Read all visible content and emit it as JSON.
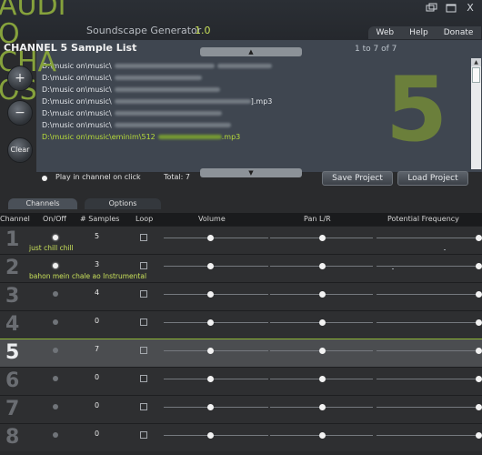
{
  "header": {
    "logo_lines": [
      "AUDI",
      "O",
      "CHA",
      "OS"
    ],
    "app_title": "Soundscape Generator",
    "version": "1.0",
    "window_icons": [
      "restore-icon",
      "maximize-icon",
      "close-icon"
    ],
    "close_glyph": "X",
    "menu": [
      "Web",
      "Help",
      "Donate"
    ]
  },
  "sample_panel": {
    "title": "CHANNEL 5 Sample List",
    "count": "1 to 7 of 7",
    "big_number": "5",
    "items": [
      {
        "prefix": "D:\\music on\\music\\",
        "suffix": ""
      },
      {
        "prefix": "D:\\music on\\music\\",
        "suffix": ""
      },
      {
        "prefix": "D:\\music on\\music\\",
        "suffix": ""
      },
      {
        "prefix": "D:\\music on\\music\\",
        "suffix": "].mp3"
      },
      {
        "prefix": "D:\\music on\\music\\",
        "suffix": ""
      },
      {
        "prefix": "D:\\music on\\music\\",
        "suffix": ""
      },
      {
        "prefix": "D:\\music on\\music\\eminim\\512",
        "suffix": ".mp3"
      }
    ],
    "play_in_channel_label": "Play in channel on click",
    "total_label": "Total: 7",
    "save_button": "Save Project",
    "load_button": "Load Project"
  },
  "side_buttons": {
    "add": "+",
    "remove": "−",
    "clear": "Clear"
  },
  "tabs": [
    "Channels",
    "Options"
  ],
  "columns": [
    "Channel",
    "On/Off",
    "# Samples",
    "Loop",
    "Volume",
    "Pan L/R",
    "Potential Frequency"
  ],
  "channels": [
    {
      "num": "1",
      "name": "just chill chill",
      "on": true,
      "samples": "5",
      "volume": 0.44,
      "pan": 0.5,
      "freq": 0.98
    },
    {
      "num": "2",
      "name": "bahon mein chale ao Instrumental",
      "on": true,
      "samples": "3",
      "volume": 0.44,
      "pan": 0.5,
      "freq": 0.98
    },
    {
      "num": "3",
      "name": "",
      "on": false,
      "samples": "4",
      "volume": 0.44,
      "pan": 0.5,
      "freq": 0.98
    },
    {
      "num": "4",
      "name": "",
      "on": false,
      "samples": "0",
      "volume": 0.44,
      "pan": 0.5,
      "freq": 0.98
    },
    {
      "num": "5",
      "name": "",
      "on": false,
      "samples": "7",
      "volume": 0.44,
      "pan": 0.5,
      "freq": 0.98,
      "selected": true
    },
    {
      "num": "6",
      "name": "",
      "on": false,
      "samples": "0",
      "volume": 0.44,
      "pan": 0.5,
      "freq": 0.98
    },
    {
      "num": "7",
      "name": "",
      "on": false,
      "samples": "0",
      "volume": 0.44,
      "pan": 0.5,
      "freq": 0.98
    },
    {
      "num": "8",
      "name": "",
      "on": false,
      "samples": "0",
      "volume": 0.44,
      "pan": 0.5,
      "freq": 0.98
    }
  ],
  "colors": {
    "accent": "#86a23c",
    "active_text": "#b7dc3a",
    "big_number": "#6b7f3b"
  }
}
